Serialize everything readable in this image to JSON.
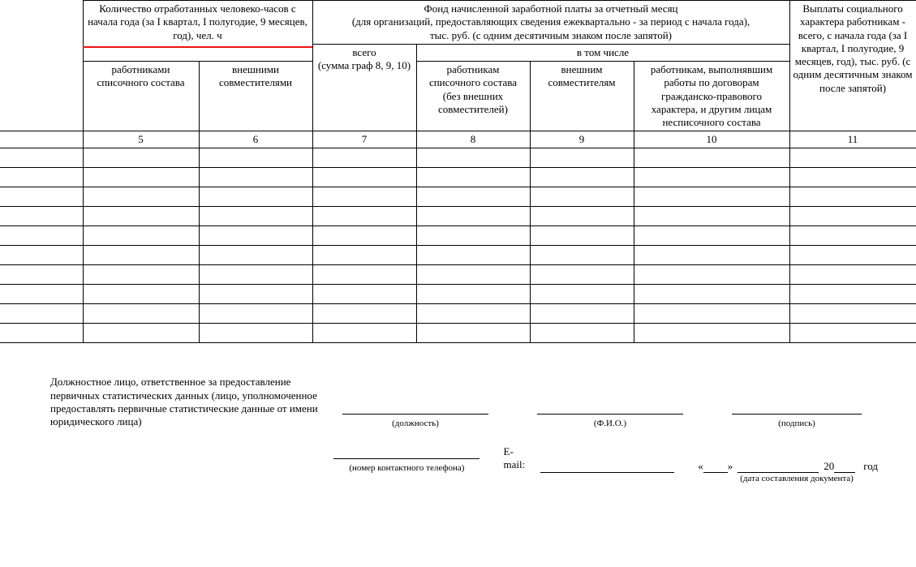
{
  "header": {
    "col_group_hours": "Количество отработанных человеко-часов с начала года (за I квартал, I полугодие, 9 месяцев, год), чел. ч",
    "col_group_fund": "Фонд начисленной заработной платы за отчетный месяц",
    "col_group_fund_sub": "(для организаций, предоставляющих сведения ежеквартально - за период с начала года),",
    "col_group_fund_sub2": "тыс. руб. (с одним десятичным знаком после запятой)",
    "col_group_social": "Выплаты социального характера работникам - всего, с начала года (за I квартал, I полугодие, 9 месяцев, год), тыс. руб. (с одним десятичным знаком после запятой)",
    "col5": "работниками списочного состава",
    "col6": "внешними совместителями",
    "col7_a": "всего",
    "col7_b": "(сумма граф 8, 9, 10)",
    "col_incl": "в том числе",
    "col8": "работникам списочного состава (без внешних совместителей)",
    "col9": "внешним совместителям",
    "col10": "работникам, выполнявшим работы по договорам гражданско-правового характера, и другим лицам несписочного состава",
    "num5": "5",
    "num6": "6",
    "num7": "7",
    "num8": "8",
    "num9": "9",
    "num10": "10",
    "num11": "11"
  },
  "sig": {
    "resp": "Должностное лицо, ответственное за предоставление первичных статистических данных (лицо, уполномоченное предоставлять первичные статистические данные от имени юридического лица)",
    "position": "(должность)",
    "fio": "(Ф.И.О.)",
    "sign": "(подпись)",
    "phone": "(номер контактного телефона)",
    "email": "E-mail:",
    "date_open": "«",
    "date_close": "»",
    "year20": "20",
    "year_word": "год",
    "doc_date": "(дата составления документа)"
  }
}
